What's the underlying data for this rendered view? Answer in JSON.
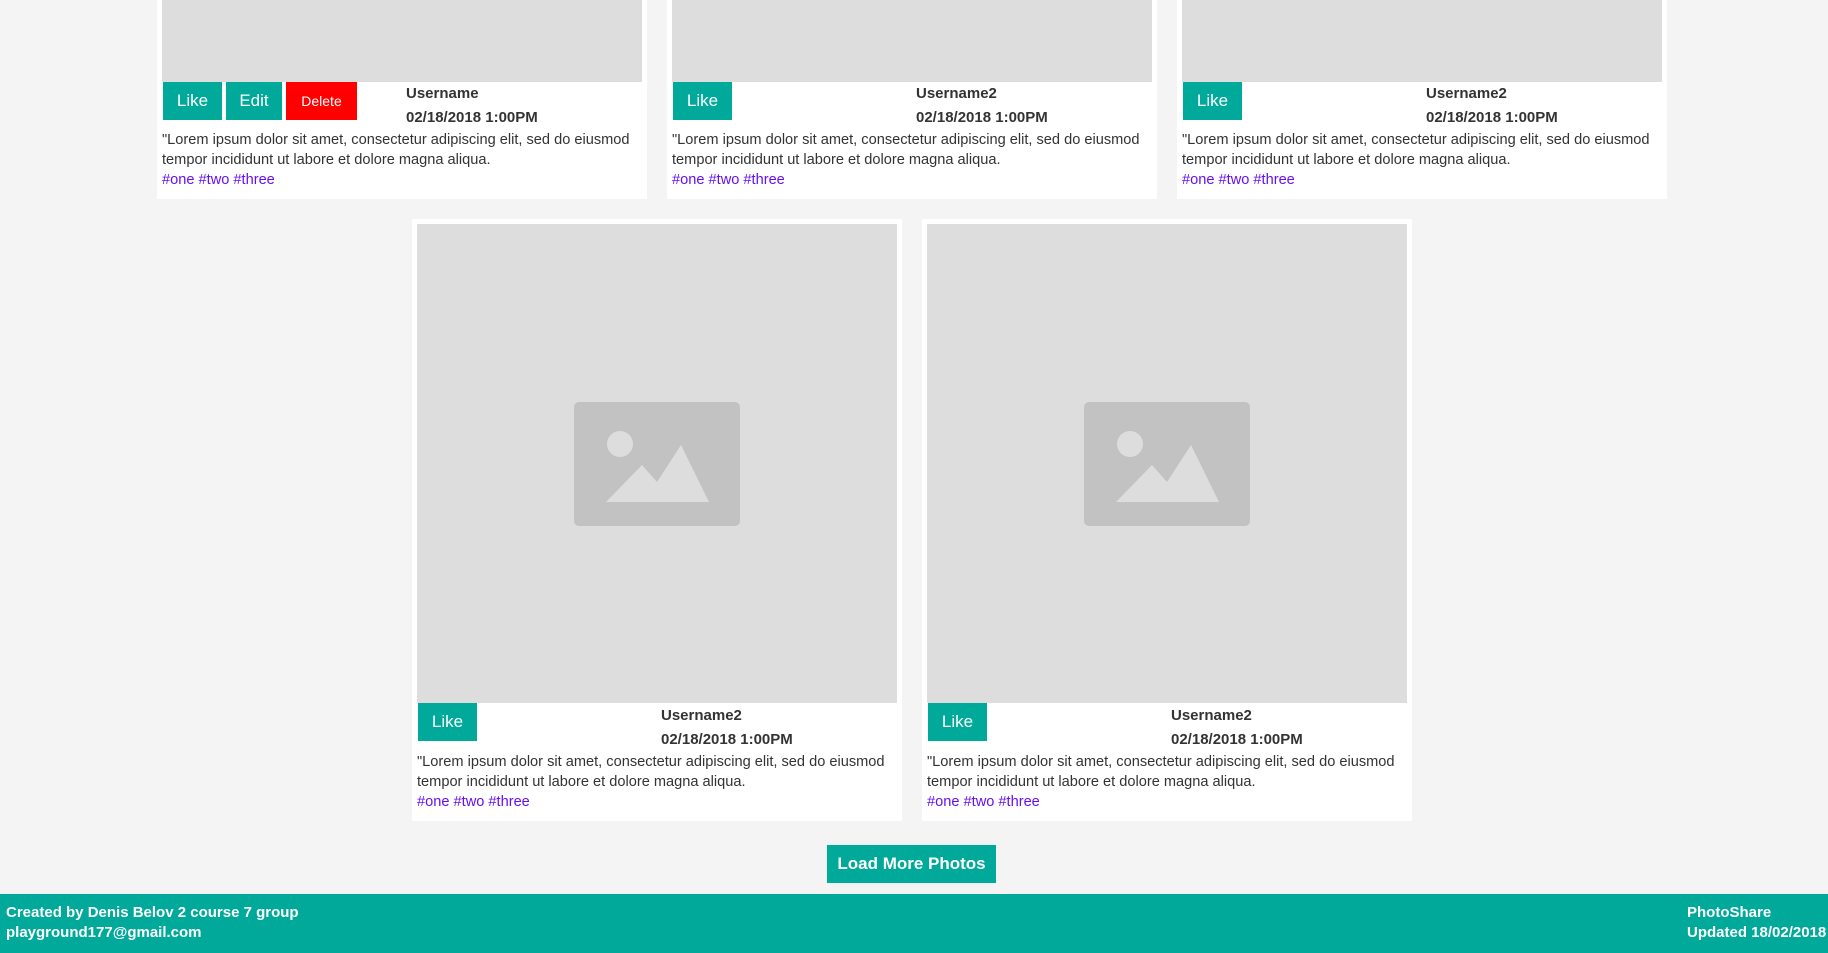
{
  "posts": [
    {
      "like_label": "Like",
      "edit_label": "Edit",
      "delete_label": "Delete",
      "username": "Username",
      "date": "02/18/2018 1:00PM",
      "description": "\"Lorem ipsum dolor sit amet, consectetur adipiscing elit, sed do eiusmod tempor incididunt ut labore et dolore magna aliqua.",
      "tags": [
        "#one",
        "#two",
        "#three"
      ]
    },
    {
      "like_label": "Like",
      "username": "Username2",
      "date": "02/18/2018 1:00PM",
      "description": "\"Lorem ipsum dolor sit amet, consectetur adipiscing elit, sed do eiusmod tempor incididunt ut labore et dolore magna aliqua.",
      "tags": [
        "#one",
        "#two",
        "#three"
      ]
    },
    {
      "like_label": "Like",
      "username": "Username2",
      "date": "02/18/2018 1:00PM",
      "description": "\"Lorem ipsum dolor sit amet, consectetur adipiscing elit, sed do eiusmod tempor incididunt ut labore et dolore magna aliqua.",
      "tags": [
        "#one",
        "#two",
        "#three"
      ]
    },
    {
      "like_label": "Like",
      "username": "Username2",
      "date": "02/18/2018 1:00PM",
      "description": "\"Lorem ipsum dolor sit amet, consectetur adipiscing elit, sed do eiusmod tempor incididunt ut labore et dolore magna aliqua.",
      "tags": [
        "#one",
        "#two",
        "#three"
      ]
    },
    {
      "like_label": "Like",
      "username": "Username2",
      "date": "02/18/2018 1:00PM",
      "description": "\"Lorem ipsum dolor sit amet, consectetur adipiscing elit, sed do eiusmod tempor incididunt ut labore et dolore magna aliqua.",
      "tags": [
        "#one",
        "#two",
        "#three"
      ]
    }
  ],
  "load_more_label": "Load More Photos",
  "footer": {
    "credit": "Created by Denis Belov 2 course 7 group",
    "email": "playground177@gmail.com",
    "app_name": "PhotoShare",
    "updated": "Updated 18/02/2018"
  },
  "colors": {
    "accent": "#00a99a",
    "danger": "#ff0000",
    "tag": "#6610f2",
    "background": "#f4f4f4",
    "placeholder": "#dddddd"
  },
  "icons": {
    "photo_placeholder": "image-placeholder-icon"
  }
}
